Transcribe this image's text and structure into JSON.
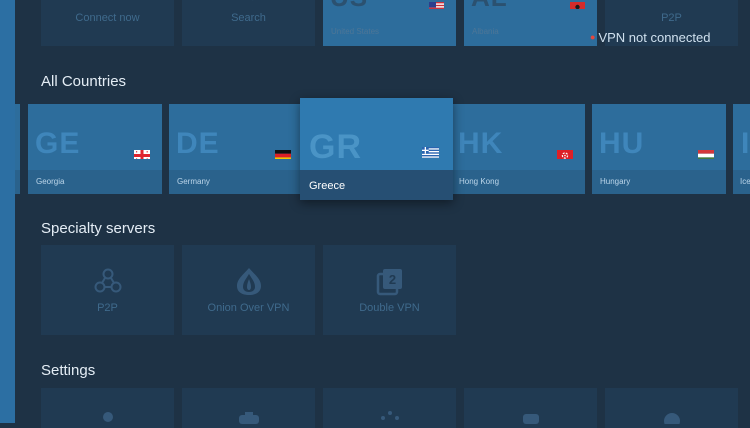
{
  "status": {
    "text": "VPN not connected",
    "dot_color": "#e8463c"
  },
  "top_row": {
    "connect_label": "Connect now",
    "search_label": "Search",
    "us": {
      "code": "US",
      "name": "United States"
    },
    "al": {
      "code": "AL",
      "name": "Albania"
    },
    "p2p_label": "P2P"
  },
  "sections": {
    "all_countries": "All Countries",
    "specialty": "Specialty servers",
    "settings": "Settings"
  },
  "countries": [
    {
      "code": "GE",
      "name": "Georgia"
    },
    {
      "code": "DE",
      "name": "Germany"
    },
    {
      "code": "GR",
      "name": "Greece"
    },
    {
      "code": "HK",
      "name": "Hong Kong"
    },
    {
      "code": "HU",
      "name": "Hungary"
    },
    {
      "code": "I",
      "name": "Ice"
    }
  ],
  "specialty": {
    "p2p": "P2P",
    "onion": "Onion Over VPN",
    "double": "Double VPN",
    "double_icon_digit": "2"
  },
  "colors": {
    "accent": "#2c6fa3",
    "selected": "#2f7ab0",
    "tile": "#2d6d9c",
    "background": "#1e3245"
  }
}
